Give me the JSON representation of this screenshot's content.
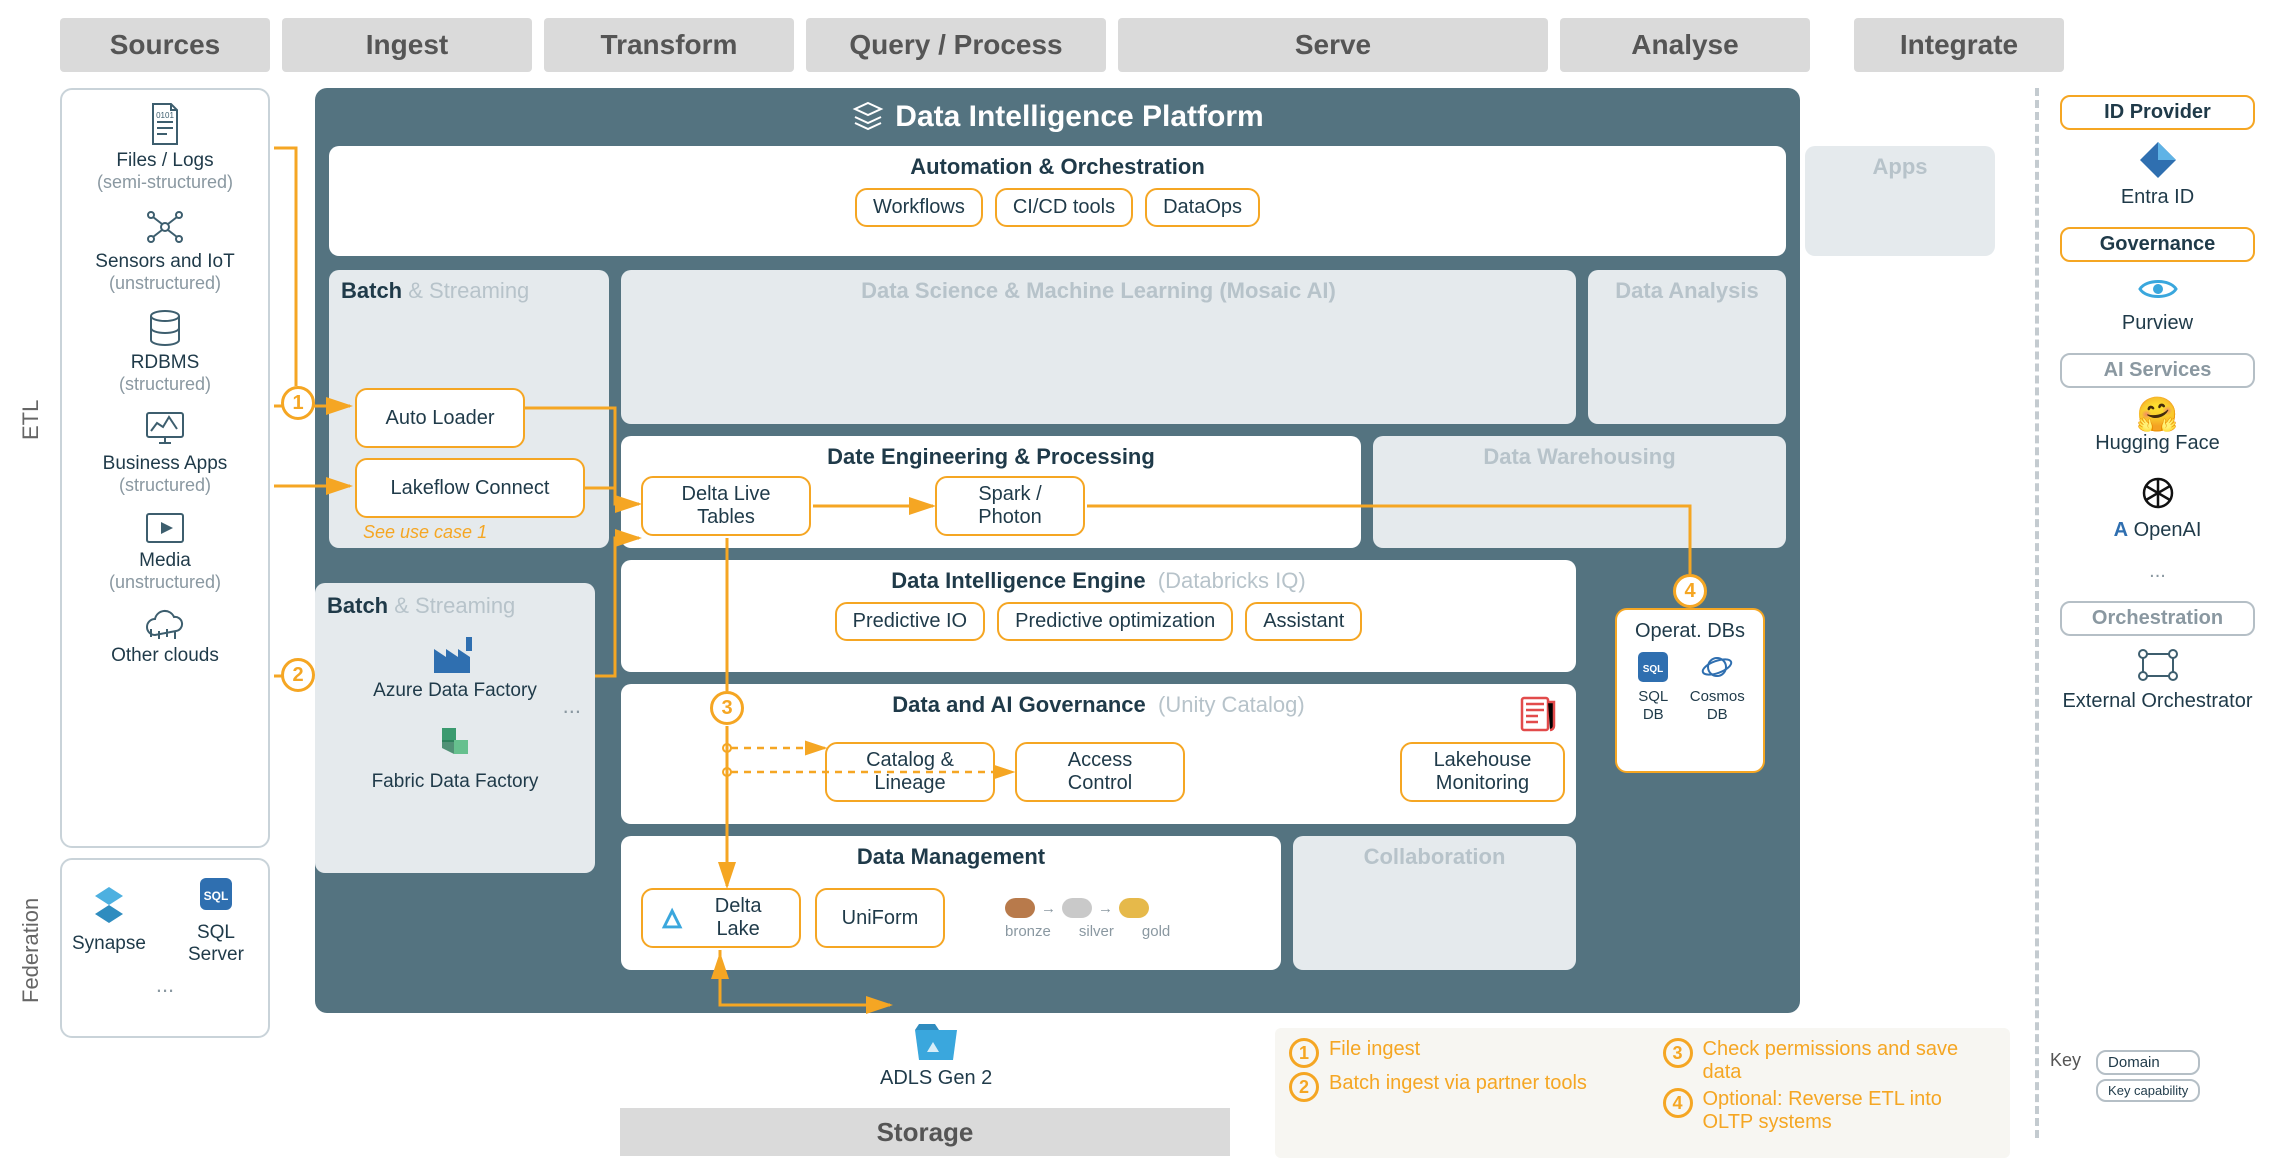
{
  "headers": {
    "sources": "Sources",
    "ingest": "Ingest",
    "transform": "Transform",
    "query_process": "Query / Process",
    "serve": "Serve",
    "analyse": "Analyse",
    "integrate": "Integrate",
    "storage": "Storage"
  },
  "side_labels": {
    "etl": "ETL",
    "federation": "Federation"
  },
  "sources_etl": [
    {
      "title": "Files / Logs",
      "sub": "(semi-structured)"
    },
    {
      "title": "Sensors and IoT",
      "sub": "(unstructured)"
    },
    {
      "title": "RDBMS",
      "sub": "(structured)"
    },
    {
      "title": "Business Apps",
      "sub": "(structured)"
    },
    {
      "title": "Media",
      "sub": "(unstructured)"
    },
    {
      "title": "Other clouds",
      "sub": ""
    }
  ],
  "sources_fed": {
    "left": "Synapse",
    "right": "SQL Server",
    "more": "..."
  },
  "platform_title": "Data Intelligence Platform",
  "row_automation": {
    "title": "Automation & Orchestration",
    "chips": [
      "Workflows",
      "CI/CD tools",
      "DataOps"
    ]
  },
  "apps_placeholder": "Apps",
  "batch_stream_label": {
    "a": "Batch",
    "b": " & Streaming"
  },
  "auto_loader": "Auto Loader",
  "lakeflow": "Lakeflow Connect",
  "see_uc": "See use case 1",
  "ds_ml_title": "Data Science & Machine Learning  (Mosaic AI)",
  "data_analysis_title": "Data Analysis",
  "de_title": "Date Engineering & Processing",
  "dlt": "Delta Live Tables",
  "spark": "Spark / Photon",
  "dw_title": "Data Warehousing",
  "di_engine": {
    "title": "Data Intelligence Engine",
    "paren": "(Databricks IQ)"
  },
  "di_chips": {
    "pio": "Predictive IO",
    "popt": "Predictive optimization",
    "assist": "Assistant"
  },
  "operat_dbs": "Operat. DBs",
  "sql_db": "SQL DB",
  "cosmos": "Cosmos DB",
  "gov": {
    "title": "Data and AI Governance",
    "paren": "(Unity Catalog)"
  },
  "gov_chips": {
    "cat": "Catalog & Lineage",
    "acc": "Access Control",
    "lm": "Lakehouse Monitoring"
  },
  "dm_title": "Data Management",
  "collab_title": "Collaboration",
  "delta_lake": "Delta Lake",
  "uniform": "UniForm",
  "medallion": {
    "bronze": "bronze",
    "silver": "silver",
    "gold": "gold"
  },
  "adls": "ADLS Gen 2",
  "ext_ingest": {
    "adf": "Azure Data Factory",
    "fdf": "Fabric Data Factory",
    "more": "..."
  },
  "integrate": {
    "idp": "ID Provider",
    "entra": "Entra ID",
    "governance": "Governance",
    "purview": "Purview",
    "ai_services": "AI Services",
    "hf": "Hugging Face",
    "openai": "OpenAI",
    "more": "...",
    "orchestration": "Orchestration",
    "ext_orch": "External Orchestrator"
  },
  "legend": {
    "s1": "File ingest",
    "s2": "Batch ingest via partner tools",
    "s3": "Check permissions and save data",
    "s4": "Optional: Reverse ETL into OLTP systems"
  },
  "key": {
    "label": "Key",
    "domain": "Domain",
    "cap": "Key capability"
  },
  "colors": {
    "accent": "#f5a623",
    "platform": "#547380",
    "muted": "#b7c3ca",
    "bronze": "#b87a4b",
    "silver": "#c9c9c9",
    "gold": "#e6b94a"
  }
}
